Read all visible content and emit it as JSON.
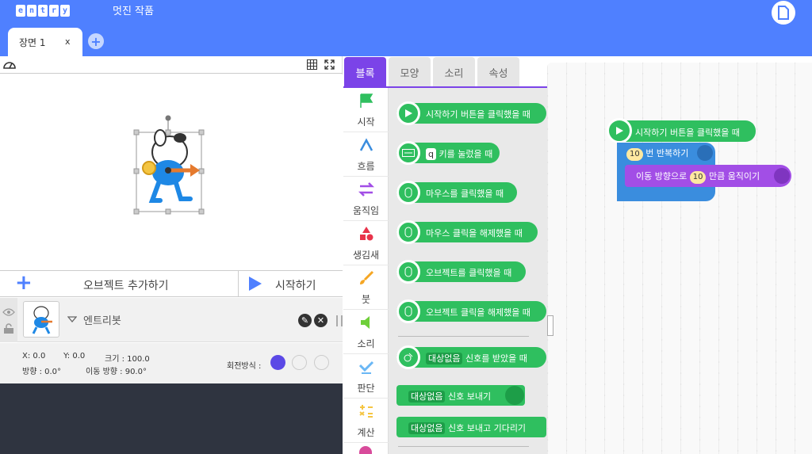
{
  "header": {
    "logo_letters": [
      "e",
      "n",
      "t",
      "r",
      "y"
    ],
    "project_title": "멋진 작품",
    "scene_tab_label": "장면 1",
    "scene_tab_close": "x",
    "add_scene": "+"
  },
  "stage_toolbar": {
    "speed_icon": "speedometer-icon",
    "grid_icon": "grid-icon",
    "fullscreen_icon": "fullscreen-icon"
  },
  "actions": {
    "add_object_label": "오브젝트 추가하기",
    "start_label": "시작하기"
  },
  "object": {
    "name": "엔트리봇",
    "x": "X: 0.0",
    "y": "Y: 0.0",
    "size": "크기 : 100.0",
    "direction": "방향 : 0.0°",
    "move_direction": "이동 방향 : 90.0°",
    "rotation_label": "회전방식 :"
  },
  "block_tabs": [
    "블록",
    "모양",
    "소리",
    "속성"
  ],
  "categories": [
    "시작",
    "흐름",
    "움직임",
    "생김새",
    "붓",
    "소리",
    "판단",
    "계산"
  ],
  "palette_blocks": [
    "시작하기 버튼을 클릭했을 때",
    "키를 눌렀을 때",
    "마우스를 클릭했을 때",
    "마우스 클릭을 해제했을 때",
    "오브젝트를 클릭했을 때",
    "오브젝트 클릭을 해제했을 때",
    "신호를 받았을 때",
    "신호 보내기",
    "신호 보내고 기다리기"
  ],
  "palette_key": "q",
  "palette_signal": "대상없음",
  "script": {
    "trigger": "시작하기 버튼을 클릭했을 때",
    "repeat_count": "10",
    "repeat_label": "번 반복하기",
    "move_prefix": "이동 방향으로",
    "move_amount": "10",
    "move_suffix": "만큼 움직이기"
  },
  "colors": {
    "header_blue": "#4f80ff",
    "start_green": "#2fbf5f",
    "flow_blue": "#3a8dde",
    "move_purple": "#a24ee6",
    "active_tab_purple": "#7b43e8"
  }
}
